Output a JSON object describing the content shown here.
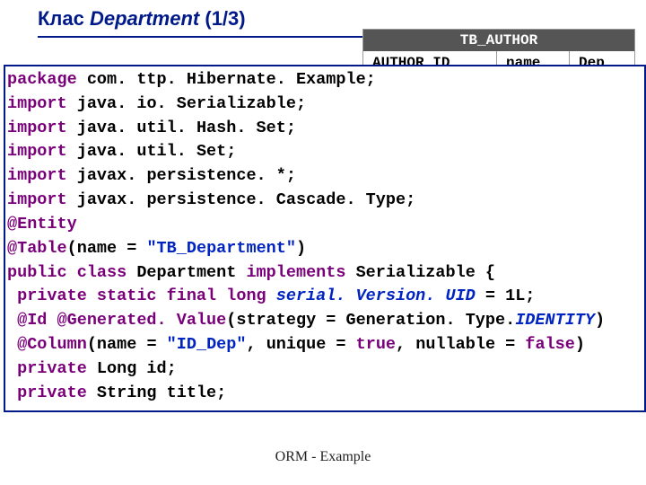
{
  "title": {
    "prefix": "Клас ",
    "word": "Department",
    "suffix": " (1/3)"
  },
  "tables": {
    "author": {
      "name": "TB_AUTHOR",
      "cols": [
        "AUTHOR_ID",
        "name",
        "Dep"
      ]
    },
    "department": {
      "name": "TB_Department",
      "cols": [
        "ID_Dep",
        "title"
      ]
    }
  },
  "code": {
    "l01a": "package",
    "l01b": " com. ttp. Hibernate. Example;",
    "l02a": "import",
    "l02b": " java. io. Serializable;",
    "l03a": "import",
    "l03b": " java. util. Hash. Set;",
    "l04a": "import",
    "l04b": " java. util. Set;",
    "l05a": "import",
    "l05b": " javax. persistence. *;",
    "l06a": "import",
    "l06b": " javax. persistence. Cascade. Type;",
    "l07": "@Entity",
    "l08a": "@Table",
    "l08b": "(name = ",
    "l08c": "\"TB_Department\"",
    "l08d": ")",
    "l09a": "public class ",
    "l09b": "Department ",
    "l09c": "implements ",
    "l09d": "Serializable {",
    "l10a": " private static final long ",
    "l10b": "serial. Version. UID",
    "l10c": " = 1L;",
    "l11a": " @Id @Generated. Value",
    "l11b": "(strategy = Generation. Type.",
    "l11c": "IDENTITY",
    "l11d": ")",
    "l12a": " @Column",
    "l12b": "(name = ",
    "l12c": "\"ID_Dep\"",
    "l12d": ", unique = ",
    "l12e": "true",
    "l12f": ", nullable = ",
    "l12g": "false",
    "l12h": ")",
    "l13a": " private ",
    "l13b": "Long id;",
    "l14a": " private ",
    "l14b": "String title;"
  },
  "footer": "ORM - Example"
}
